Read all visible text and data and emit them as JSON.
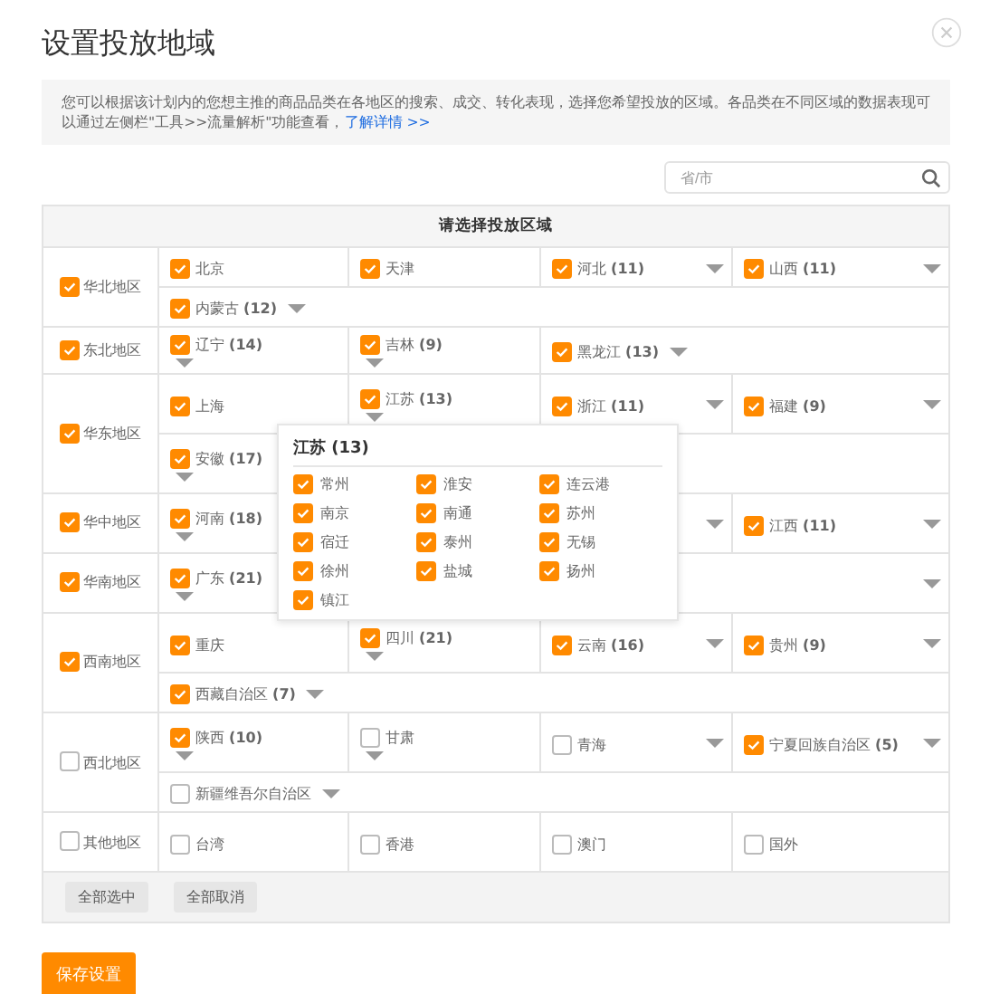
{
  "dialog": {
    "title": "设置投放地域",
    "notice": "您可以根据该计划内的您想主推的商品品类在各地区的搜索、成交、转化表现，选择您希望投放的区域。各品类在不同区域的数据表现可以通过左侧栏\"工具>>流量解析\"功能查看，",
    "notice_link": "了解详情 >>"
  },
  "search": {
    "placeholder": "省/市"
  },
  "table": {
    "heading": "请选择投放区域",
    "regions": [
      {
        "label": "华北地区",
        "checked": true,
        "lines": [
          [
            {
              "kind": "plain",
              "label": "北京",
              "checked": true
            },
            {
              "kind": "plain",
              "label": "天津",
              "checked": true
            },
            {
              "kind": "caret_end",
              "label": "河北 **(11)**",
              "checked": true
            },
            {
              "kind": "caret_end",
              "label": "山西 **(11)**",
              "checked": true
            }
          ],
          [
            {
              "kind": "caret_inline",
              "label": "内蒙古 **(12)**",
              "checked": true
            }
          ]
        ]
      },
      {
        "label": "东北地区",
        "checked": true,
        "lines": [
          [
            {
              "kind": "caret_below",
              "label": "辽宁 **(14)**",
              "checked": true
            },
            {
              "kind": "caret_below",
              "label": "吉林 **(9)**",
              "checked": true
            },
            {
              "kind": "caret_inline",
              "label": "黑龙江 **(13)**",
              "checked": true
            }
          ]
        ]
      },
      {
        "label": "华东地区",
        "checked": true,
        "lines": [
          [
            {
              "kind": "plain",
              "label": "上海",
              "checked": true
            },
            {
              "kind": "caret_below",
              "label": "江苏 **(13)**",
              "checked": true
            },
            {
              "kind": "caret_end",
              "label": "浙江 **(11)**",
              "checked": true
            },
            {
              "kind": "caret_end",
              "label": "福建 **(9)**",
              "checked": true
            }
          ],
          [
            {
              "kind": "caret_below",
              "label": "安徽 **(17)**",
              "checked": true
            }
          ]
        ]
      },
      {
        "label": "华中地区",
        "checked": true,
        "lines": [
          [
            {
              "kind": "caret_below",
              "label": "河南 **(18)**",
              "checked": true
            },
            {
              "kind": "blank"
            },
            {
              "kind": "caret_end"
            },
            {
              "kind": "caret_end",
              "label": "江西 **(11)**",
              "checked": true
            }
          ]
        ]
      },
      {
        "label": "华南地区",
        "checked": true,
        "lines": [
          [
            {
              "kind": "caret_below",
              "label": "广东 **(21)**",
              "checked": true
            },
            {
              "kind": "blank"
            },
            {
              "kind": "caret_end"
            }
          ]
        ]
      },
      {
        "label": "西南地区",
        "checked": true,
        "lines": [
          [
            {
              "kind": "plain",
              "label": "重庆",
              "checked": true
            },
            {
              "kind": "caret_below",
              "label": "四川 **(21)**",
              "checked": true
            },
            {
              "kind": "caret_end",
              "label": "云南 **(16)**",
              "checked": true
            },
            {
              "kind": "caret_end",
              "label": "贵州 **(9)**",
              "checked": true
            }
          ],
          [
            {
              "kind": "caret_inline",
              "label": "西藏自治区 **(7)**",
              "checked": true
            }
          ]
        ]
      },
      {
        "label": "西北地区",
        "checked": false,
        "lines": [
          [
            {
              "kind": "caret_below",
              "label": "陕西 **(10)**",
              "checked": true
            },
            {
              "kind": "caret_below",
              "label": "甘肃",
              "checked": false
            },
            {
              "kind": "caret_end",
              "label": "青海",
              "checked": false
            },
            {
              "kind": "caret_end",
              "label": "宁夏回族自治区 **(5)**",
              "checked": true
            }
          ],
          [
            {
              "kind": "caret_inline",
              "label": "新疆维吾尔自治区",
              "checked": false
            }
          ]
        ]
      },
      {
        "label": "其他地区",
        "checked": false,
        "lines": [
          [
            {
              "kind": "plain",
              "label": "台湾",
              "checked": false
            },
            {
              "kind": "plain",
              "label": "香港",
              "checked": false
            },
            {
              "kind": "plain",
              "label": "澳门",
              "checked": false
            },
            {
              "kind": "plain",
              "label": "国外",
              "checked": false
            }
          ]
        ]
      }
    ],
    "buttons": [
      "全部选中",
      "全部取消"
    ]
  },
  "popup": {
    "title": "江苏 (13)",
    "cities": [
      {
        "label": "常州",
        "checked": true
      },
      {
        "label": "淮安",
        "checked": true
      },
      {
        "label": "连云港",
        "checked": true
      },
      {
        "label": "南京",
        "checked": true
      },
      {
        "label": "南通",
        "checked": true
      },
      {
        "label": "苏州",
        "checked": true
      },
      {
        "label": "宿迁",
        "checked": true
      },
      {
        "label": "泰州",
        "checked": true
      },
      {
        "label": "无锡",
        "checked": true
      },
      {
        "label": "徐州",
        "checked": true
      },
      {
        "label": "盐城",
        "checked": true
      },
      {
        "label": "扬州",
        "checked": true
      },
      {
        "label": "镇江",
        "checked": true
      }
    ]
  },
  "save_button": "保存设置"
}
